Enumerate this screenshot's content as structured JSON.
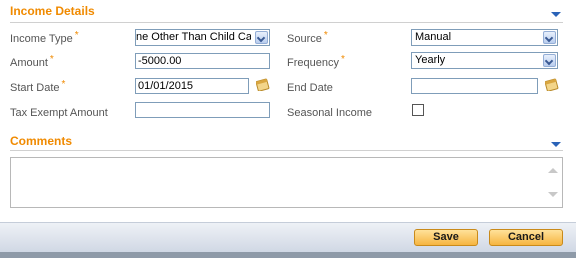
{
  "income_details": {
    "title": "Income Details",
    "income_type": {
      "label": "Income Type",
      "value": "ne Other Than Child Care"
    },
    "source": {
      "label": "Source",
      "value": "Manual"
    },
    "amount": {
      "label": "Amount",
      "value": "-5000.00"
    },
    "frequency": {
      "label": "Frequency",
      "value": "Yearly"
    },
    "start_date": {
      "label": "Start Date",
      "value": "01/01/2015"
    },
    "end_date": {
      "label": "End Date",
      "value": ""
    },
    "tax_exempt_amount": {
      "label": "Tax Exempt Amount",
      "value": ""
    },
    "seasonal_income": {
      "label": "Seasonal Income",
      "checked": false
    },
    "required_marker": "*"
  },
  "comments": {
    "title": "Comments",
    "value": ""
  },
  "footer": {
    "save_label": "Save",
    "cancel_label": "Cancel"
  },
  "colors": {
    "accent": "#f08a00",
    "button": "#f6b440",
    "link": "#2a63b8"
  },
  "icons": [
    "chevron-down-icon",
    "calendar-icon",
    "scroll-arrow-icon"
  ]
}
